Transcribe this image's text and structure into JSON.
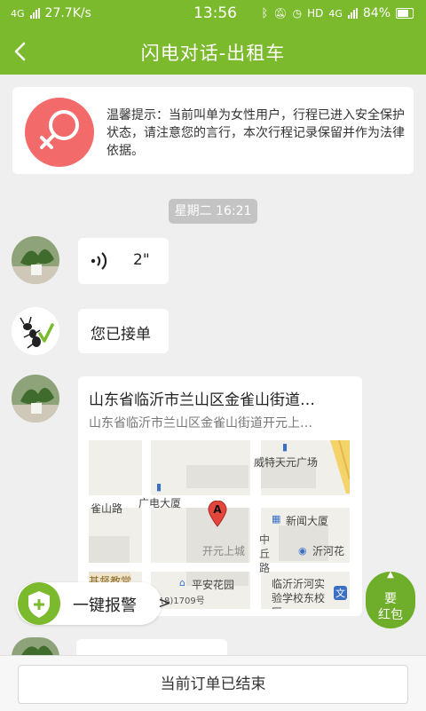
{
  "status_bar": {
    "network": "4G",
    "speed": "27.7K/s",
    "time": "13:56",
    "hd": "HD",
    "net2": "4G",
    "battery": "84%"
  },
  "header": {
    "title": "闪电对话-出租车"
  },
  "notice": {
    "text": "温馨提示：当前叫单为女性用户，行程已进入安全保护状态，请注意您的言行，本次行程记录保留并作为法律依据。",
    "icon": "female-icon",
    "accent": "#f26a6a"
  },
  "timestamp": "星期二 16:21",
  "messages": [
    {
      "type": "voice",
      "duration": "2\""
    },
    {
      "type": "text",
      "text": "您已接单"
    },
    {
      "type": "location",
      "title": "山东省临沂市兰山区金雀山街道…",
      "subtitle": "山东省临沂市兰山区金雀山街道开元上…",
      "map": {
        "labels": [
          "威特天元广场",
          "广电大厦",
          "雀山路",
          "新闻大厦",
          "开元上城",
          "中丘路",
          "沂河花",
          "基督教堂",
          "平安花园",
          "临沂沂河实验学校东校区",
          "(2018)1709号"
        ],
        "marker": "A",
        "text_badge": "文"
      }
    }
  ],
  "alarm": {
    "label": "一键报警",
    "chevron": ">"
  },
  "redpack": {
    "line1": "要",
    "line2": "红包"
  },
  "footer": {
    "button_label": "当前订单已结束"
  },
  "colors": {
    "brand": "#7cba2d",
    "background": "#efefef"
  }
}
